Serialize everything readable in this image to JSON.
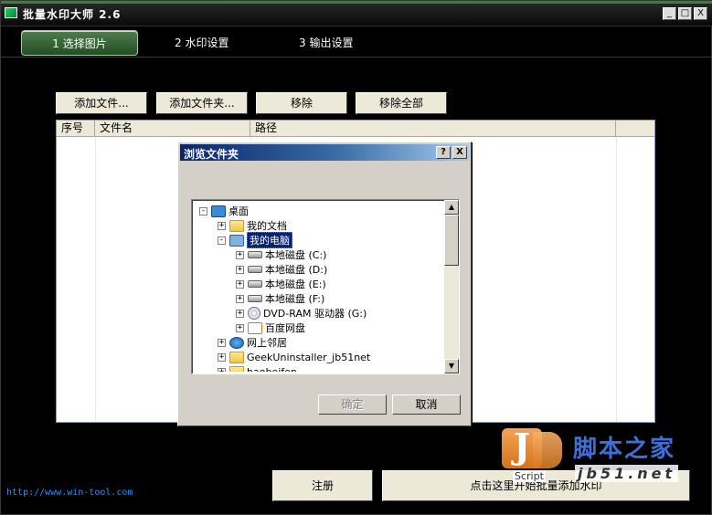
{
  "window": {
    "title": "批量水印大师 2.6",
    "controls": {
      "minimize": "_",
      "maximize": "□",
      "close": "X"
    }
  },
  "steps": [
    {
      "label": "1 选择图片",
      "active": true
    },
    {
      "label": "2 水印设置",
      "active": false
    },
    {
      "label": "3 输出设置",
      "active": false
    }
  ],
  "toolbar": {
    "add_file": "添加文件...",
    "add_folder": "添加文件夹...",
    "remove": "移除",
    "remove_all": "移除全部"
  },
  "table": {
    "columns": [
      "序号",
      "文件名",
      "路径",
      ""
    ]
  },
  "dialog": {
    "title": "浏览文件夹",
    "help": "?",
    "close": "X",
    "tree": [
      {
        "label": "桌面",
        "icon": "desktop-icon",
        "expander": "-"
      },
      {
        "label": "我的文档",
        "icon": "folder-icon",
        "expander": "+"
      },
      {
        "label": "我的电脑",
        "icon": "computer-icon",
        "expander": "-",
        "selected": true
      },
      {
        "label": "本地磁盘 (C:)",
        "icon": "disk-icon",
        "expander": "+"
      },
      {
        "label": "本地磁盘 (D:)",
        "icon": "disk-icon",
        "expander": "+"
      },
      {
        "label": "本地磁盘 (E:)",
        "icon": "disk-icon",
        "expander": "+"
      },
      {
        "label": "本地磁盘 (F:)",
        "icon": "disk-icon",
        "expander": "+"
      },
      {
        "label": "DVD-RAM 驱动器 (G:)",
        "icon": "dvd-icon",
        "expander": "+"
      },
      {
        "label": "百度网盘",
        "icon": "cloud-drive-icon",
        "expander": "+"
      },
      {
        "label": "网上邻居",
        "icon": "network-icon",
        "expander": "+"
      },
      {
        "label": "GeekUninstaller_jb51net",
        "icon": "folder-icon",
        "expander": "+"
      },
      {
        "label": "haobeifen",
        "icon": "folder-icon",
        "expander": "+"
      }
    ],
    "ok": "确定",
    "cancel": "取消"
  },
  "footer": {
    "url": "http://www.win-tool.com",
    "register": "注册",
    "start": "点击这里开始批量添加水印"
  },
  "watermark": {
    "cn": "脚本之家",
    "en": "jb51.net",
    "script": "Script"
  },
  "colors": {
    "accent_green": "#2c8a2c",
    "dialog_title": "#0a246a",
    "link_blue": "#2a8cff"
  }
}
